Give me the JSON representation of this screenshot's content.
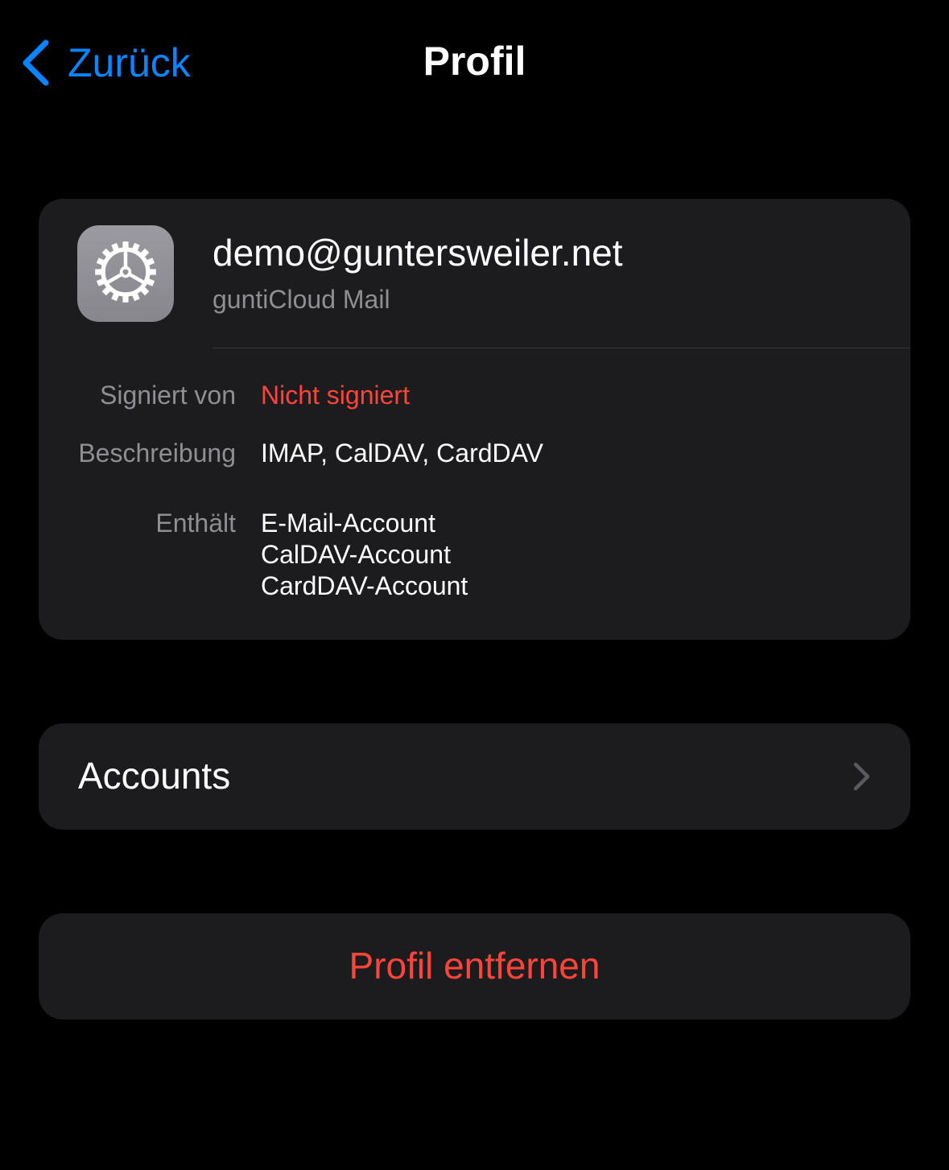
{
  "nav": {
    "back_label": "Zurück",
    "back_icon": "chevron-left-icon",
    "title": "Profil"
  },
  "profile": {
    "icon": "gear-icon",
    "title": "demo@guntersweiler.net",
    "subtitle": "guntiCloud Mail",
    "details": {
      "signed_by_label": "Signiert von",
      "signed_by_value": "Nicht signiert",
      "description_label": "Beschreibung",
      "description_value": "IMAP, CalDAV, CardDAV",
      "contains_label": "Enthält",
      "contains_items": [
        "E-Mail-Account",
        "CalDAV-Account",
        "CardDAV-Account"
      ]
    }
  },
  "accounts": {
    "label": "Accounts",
    "icon": "chevron-right-icon"
  },
  "remove": {
    "label": "Profil entfernen"
  },
  "colors": {
    "background": "#000000",
    "card": "#1c1c1e",
    "accent": "#0a84ff",
    "destructive": "#ff453a",
    "secondary_text": "#8e8e93"
  }
}
